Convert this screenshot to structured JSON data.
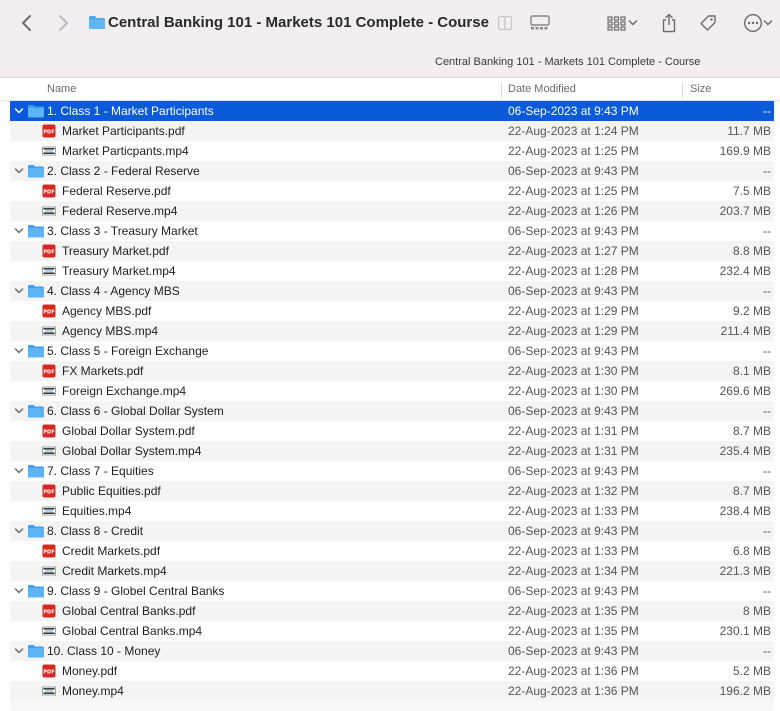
{
  "window": {
    "title": "Central Banking 101 - Markets 101 Complete - Course",
    "path_title": "Central Banking 101 - Markets 101 Complete - Course"
  },
  "columns": {
    "name": "Name",
    "date": "Date Modified",
    "size": "Size"
  },
  "colors": {
    "selection": "#0a5ad9",
    "folder": "#4aa8f0",
    "pdf": "#d8281e"
  },
  "items": [
    {
      "type": "folder",
      "name": "1. Class 1 - Market Participants",
      "date": "06-Sep-2023 at 9:43 PM",
      "size": "--"
    },
    {
      "type": "pdf",
      "name": "Market Participants.pdf",
      "date": "22-Aug-2023 at 1:24 PM",
      "size": "11.7 MB"
    },
    {
      "type": "mp4",
      "name": "Market Particpants.mp4",
      "date": "22-Aug-2023 at 1:25 PM",
      "size": "169.9 MB"
    },
    {
      "type": "folder",
      "name": "2. Class 2 - Federal Reserve",
      "date": "06-Sep-2023 at 9:43 PM",
      "size": "--"
    },
    {
      "type": "pdf",
      "name": "Federal Reserve.pdf",
      "date": "22-Aug-2023 at 1:25 PM",
      "size": "7.5 MB"
    },
    {
      "type": "mp4",
      "name": "Federal Reserve.mp4",
      "date": "22-Aug-2023 at 1:26 PM",
      "size": "203.7 MB"
    },
    {
      "type": "folder",
      "name": "3. Class 3 - Treasury Market",
      "date": "06-Sep-2023 at 9:43 PM",
      "size": "--"
    },
    {
      "type": "pdf",
      "name": "Treasury Market.pdf",
      "date": "22-Aug-2023 at 1:27 PM",
      "size": "8.8 MB"
    },
    {
      "type": "mp4",
      "name": "Treasury Market.mp4",
      "date": "22-Aug-2023 at 1:28 PM",
      "size": "232.4 MB"
    },
    {
      "type": "folder",
      "name": "4. Class 4 - Agency MBS",
      "date": "06-Sep-2023 at 9:43 PM",
      "size": "--"
    },
    {
      "type": "pdf",
      "name": "Agency MBS.pdf",
      "date": "22-Aug-2023 at 1:29 PM",
      "size": "9.2 MB"
    },
    {
      "type": "mp4",
      "name": "Agency MBS.mp4",
      "date": "22-Aug-2023 at 1:29 PM",
      "size": "211.4 MB"
    },
    {
      "type": "folder",
      "name": "5. Class 5 - Foreign Exchange",
      "date": "06-Sep-2023 at 9:43 PM",
      "size": "--"
    },
    {
      "type": "pdf",
      "name": "FX Markets.pdf",
      "date": "22-Aug-2023 at 1:30 PM",
      "size": "8.1 MB"
    },
    {
      "type": "mp4",
      "name": "Foreign Exchange.mp4",
      "date": "22-Aug-2023 at 1:30 PM",
      "size": "269.6 MB"
    },
    {
      "type": "folder",
      "name": "6. Class 6 - Global Dollar System",
      "date": "06-Sep-2023 at 9:43 PM",
      "size": "--"
    },
    {
      "type": "pdf",
      "name": "Global Dollar System.pdf",
      "date": "22-Aug-2023 at 1:31 PM",
      "size": "8.7 MB"
    },
    {
      "type": "mp4",
      "name": "Global Dollar System.mp4",
      "date": "22-Aug-2023 at 1:31 PM",
      "size": "235.4 MB"
    },
    {
      "type": "folder",
      "name": "7. Class 7 - Equities",
      "date": "06-Sep-2023 at 9:43 PM",
      "size": "--"
    },
    {
      "type": "pdf",
      "name": "Public Equities.pdf",
      "date": "22-Aug-2023 at 1:32 PM",
      "size": "8.7 MB"
    },
    {
      "type": "mp4",
      "name": "Equities.mp4",
      "date": "22-Aug-2023 at 1:33 PM",
      "size": "238.4 MB"
    },
    {
      "type": "folder",
      "name": "8. Class 8 - Credit",
      "date": "06-Sep-2023 at 9:43 PM",
      "size": "--"
    },
    {
      "type": "pdf",
      "name": "Credit Markets.pdf",
      "date": "22-Aug-2023 at 1:33 PM",
      "size": "6.8 MB"
    },
    {
      "type": "mp4",
      "name": "Credit Markets.mp4",
      "date": "22-Aug-2023 at 1:34 PM",
      "size": "221.3 MB"
    },
    {
      "type": "folder",
      "name": "9. Class 9 - Globel Central Banks",
      "date": "06-Sep-2023 at 9:43 PM",
      "size": "--"
    },
    {
      "type": "pdf",
      "name": "Global Central Banks.pdf",
      "date": "22-Aug-2023 at 1:35 PM",
      "size": "8 MB"
    },
    {
      "type": "mp4",
      "name": "Global Central Banks.mp4",
      "date": "22-Aug-2023 at 1:35 PM",
      "size": "230.1 MB"
    },
    {
      "type": "folder",
      "name": "10. Class 10 - Money",
      "date": "06-Sep-2023 at 9:43 PM",
      "size": "--"
    },
    {
      "type": "pdf",
      "name": "Money.pdf",
      "date": "22-Aug-2023 at 1:36 PM",
      "size": "5.2 MB"
    },
    {
      "type": "mp4",
      "name": "Money.mp4",
      "date": "22-Aug-2023 at 1:36 PM",
      "size": "196.2 MB"
    }
  ],
  "selected_index": 0
}
